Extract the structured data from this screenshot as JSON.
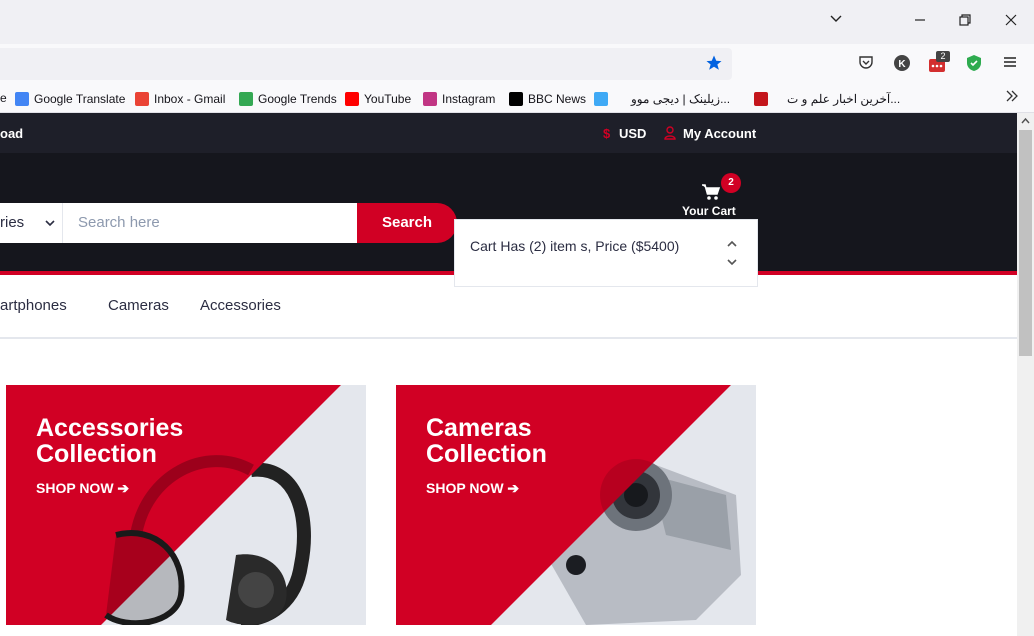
{
  "browser": {
    "bookmarks": [
      {
        "label": "Google Translate",
        "color": "#4285f4"
      },
      {
        "label": "Inbox - Gmail",
        "color": "#ea4335"
      },
      {
        "label": "Google Trends",
        "color": "#34a853"
      },
      {
        "label": "YouTube",
        "color": "#ff0000"
      },
      {
        "label": "Instagram",
        "color": "#c13584"
      },
      {
        "label": "BBC News",
        "color": "#000000"
      },
      {
        "label": "زیلینک | دیجی موو...",
        "color": "#3fa9f5"
      },
      {
        "label": "آخرین اخبار علم و ت...",
        "color": "#c4161c"
      }
    ],
    "extension_badge": "2"
  },
  "topheader": {
    "left_text": "oad",
    "currency_icon": "$",
    "currency": "USD",
    "account": "My Account"
  },
  "header": {
    "categories_text": "ries",
    "search_placeholder": "Search here",
    "search_button": "Search",
    "cart_label": "Your Cart",
    "cart_count": "2",
    "cart_dropdown_text": "Cart Has (2) item s, Price ($5400)"
  },
  "nav": {
    "items": [
      "artphones",
      "Cameras",
      "Accessories"
    ]
  },
  "collections": [
    {
      "title_line1": "Accessories",
      "title_line2": "Collection",
      "cta": "SHOP NOW"
    },
    {
      "title_line1": "Cameras",
      "title_line2": "Collection",
      "cta": "SHOP NOW"
    }
  ],
  "colors": {
    "accent": "#d10024",
    "dark": "#15161d",
    "topbar": "#1e1f29"
  }
}
